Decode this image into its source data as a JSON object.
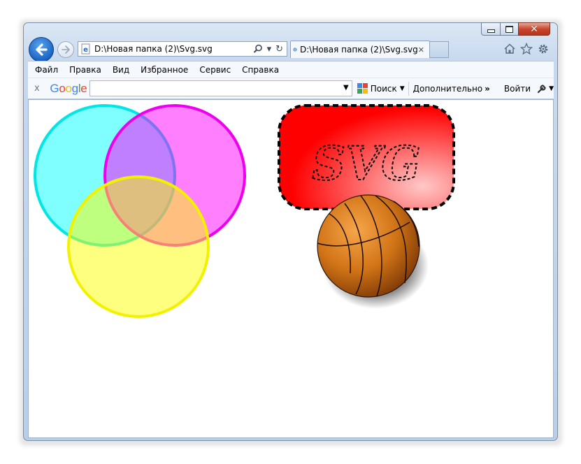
{
  "window": {
    "captions": {
      "minimize": "minimize",
      "maximize": "maximize",
      "close": "✕"
    }
  },
  "nav": {
    "address_text": "D:\\Новая папка (2)\\Svg.svg",
    "tab_title": "D:\\Новая папка (2)\\Svg.svg",
    "tab_close": "✕",
    "search_glyph": "⚲",
    "dropdown_glyph": "▾",
    "refresh_glyph": "↻"
  },
  "menu": {
    "items": [
      {
        "label": "Файл"
      },
      {
        "label": "Правка"
      },
      {
        "label": "Вид"
      },
      {
        "label": "Избранное"
      },
      {
        "label": "Сервис"
      },
      {
        "label": "Справка"
      }
    ]
  },
  "google_toolbar": {
    "close": "x",
    "logo_letters": [
      "G",
      "o",
      "o",
      "g",
      "l",
      "e"
    ],
    "logo_colors": [
      "#4285F4",
      "#EA4335",
      "#FBBC05",
      "#4285F4",
      "#34A853",
      "#EA4335"
    ],
    "search_value": "",
    "search_label": "Поиск",
    "more_label": "Дополнительно",
    "more_glyph": "»",
    "signin_label": "Войти"
  },
  "content": {
    "svg_text": "SVG",
    "circles": [
      {
        "name": "cyan",
        "fill": "#00ffff",
        "stroke": "#00e5e5"
      },
      {
        "name": "magenta",
        "fill": "#ff00ff",
        "stroke": "#ee00ee"
      },
      {
        "name": "yellow",
        "fill": "#ffff00",
        "stroke": "#f2f200"
      }
    ],
    "rect_colors": {
      "outer": "#ff0000",
      "highlight": "#ffc8c8"
    },
    "ball_colors": {
      "light": "#f7a64a",
      "mid": "#d07316",
      "dark": "#7a3606"
    }
  }
}
